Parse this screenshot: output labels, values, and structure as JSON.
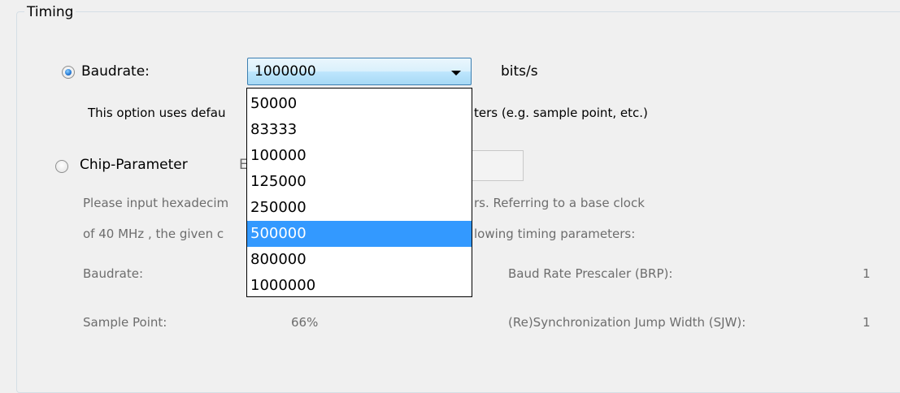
{
  "group": {
    "title": "Timing"
  },
  "baudrate_option": {
    "label": "Baudrate:",
    "selected": true,
    "combo_value": "1000000",
    "unit": "bits/s",
    "description_left": "This option uses defau",
    "description_right": "ters (e.g. sample point, etc.)"
  },
  "chip_option": {
    "label": "Chip-Parameter",
    "selected": false,
    "field_label_fragment": "E",
    "info_line1_left": "Please input hexadecim",
    "info_line1_right": "rs. Referring to a base clock",
    "info_line2_left": "of 40  MHz , the given c",
    "info_line2_right": "lowing timing parameters:"
  },
  "parameters": {
    "baudrate_label": "Baudrate:",
    "sample_point_label": "Sample Point:",
    "sample_point_value": "66%",
    "brp_label": "Baud Rate Prescaler (BRP):",
    "brp_value": "1",
    "sjw_label": "(Re)Synchronization Jump Width (SJW):",
    "sjw_value": "1"
  },
  "dropdown": {
    "options": [
      "50000",
      "83333",
      "100000",
      "125000",
      "250000",
      "500000",
      "800000",
      "1000000"
    ],
    "highlighted": "500000"
  }
}
